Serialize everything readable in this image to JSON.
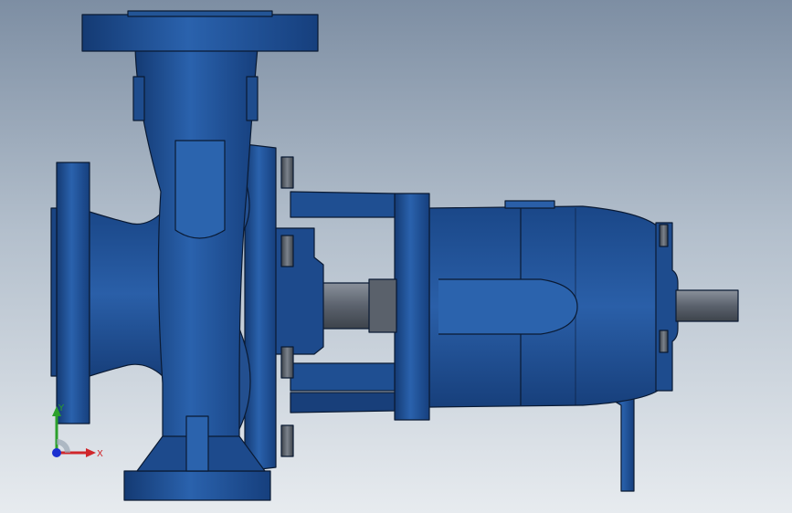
{
  "viewport": {
    "background_top": "#7d8ea3",
    "background_bottom": "#e7ebef",
    "model_color": "#1f4f92",
    "model_edge_color": "#0a1a33",
    "shaft_color": "#5f6773"
  },
  "triad": {
    "x_label": "X",
    "y_label": "Y",
    "x_color": "#d0262b",
    "y_color": "#2ca02c",
    "z_color": "#1b2fd0"
  }
}
